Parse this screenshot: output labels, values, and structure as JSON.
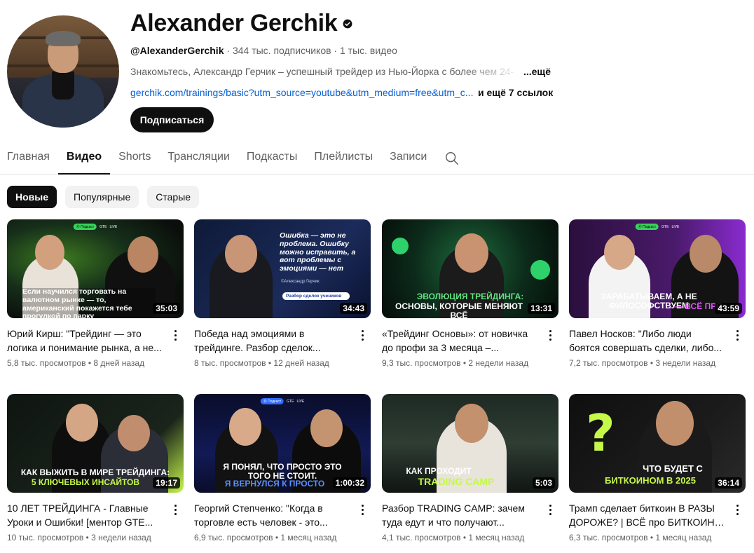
{
  "channel": {
    "name": "Alexander Gerchik",
    "handle": "@AlexanderGerchik",
    "stats": " · 344 тыс. подписчиков · 1 тыс. видео",
    "description": "Знакомьтесь, Александр Герчик – успешный трейдер из Нью-Йорка с более чем 24-",
    "description_more": "...ещё",
    "link": "gerchik.com/trainings/basic?utm_source=youtube&utm_medium=free&utm_c...",
    "links_more": "и ещё 7 ссылок",
    "subscribe_label": "Подписаться"
  },
  "tabs": [
    {
      "label": "Главная",
      "active": false
    },
    {
      "label": "Видео",
      "active": true
    },
    {
      "label": "Shorts",
      "active": false
    },
    {
      "label": "Трансляции",
      "active": false
    },
    {
      "label": "Подкасты",
      "active": false
    },
    {
      "label": "Плейлисты",
      "active": false
    },
    {
      "label": "Записи",
      "active": false
    }
  ],
  "chips": [
    {
      "label": "Новые",
      "active": true
    },
    {
      "label": "Популярные",
      "active": false
    },
    {
      "label": "Старые",
      "active": false
    }
  ],
  "videos": [
    {
      "title": "Юрий Кирш: \"Трейдинг — это логика и понимание рынка, а не...",
      "views": "5,8 тыс. просмотров",
      "age": "8 дней назад",
      "duration": "35:03",
      "thumb_text": "Если научился торговать на валютном рынке — то, американский покажется тебе прогулкой по парку"
    },
    {
      "title": "Победа над эмоциями в трейдинге. Разбор сделок...",
      "views": "8 тыс. просмотров",
      "age": "12 дней назад",
      "duration": "34:43",
      "thumb_text": "Ошибка — это не проблема. Ошибку можно исправить, а вот проблемы с эмоциями — нет",
      "thumb_sub": "©Александр Герчик",
      "thumb_tag": "Разбор сделок учеников"
    },
    {
      "title": "«Трейдинг Основы»: от новичка до профи за 3 месяца –...",
      "views": "9,3 тыс. просмотров",
      "age": "2 недели назад",
      "duration": "13:31",
      "thumb_text_acc": "ЭВОЛЮЦИЯ ТРЕЙДИНГА:",
      "thumb_text": "ОСНОВЫ, КОТОРЫЕ МЕНЯЮТ ВСЁ"
    },
    {
      "title": "Павел Носков: \"Либо люди боятся совершать сделки, либо...",
      "views": "7,2 тыс. просмотров",
      "age": "3 недели назад",
      "duration": "43:59",
      "thumb_text": "ЗАРАБАТЫВАЕМ, А НЕ ФИЛОСОФСТВУЕМ",
      "thumb_text_acc": "— ВСЁ ПРО"
    },
    {
      "title": "10 ЛЕТ ТРЕЙДИНГА - Главные Уроки и Ошибки! [ментор GTE...",
      "views": "10 тыс. просмотров",
      "age": "3 недели назад",
      "duration": "19:17",
      "thumb_text": "КАК ВЫЖИТЬ В МИРЕ ТРЕЙДИНГА:",
      "thumb_text_acc": "5 КЛЮЧЕВЫХ ИНСАЙТОВ"
    },
    {
      "title": "Георгий Степченко: \"Когда в торговле есть человек - это...",
      "views": "6,9 тыс. просмотров",
      "age": "1 месяц назад",
      "duration": "1:00:32",
      "thumb_text": "Я ПОНЯЛ, ЧТО ПРОСТО ЭТО ТОГО НЕ СТОИТ.",
      "thumb_text_acc": "Я ВЕРНУЛСЯ К ПРОСТО"
    },
    {
      "title": "Разбор TRADING CAMP: зачем туда едут и что получают...",
      "views": "4,1 тыс. просмотров",
      "age": "1 месяц назад",
      "duration": "5:03",
      "thumb_text": "КАК ПРОХОДИТ",
      "thumb_text_acc": "TRADING CAMP"
    },
    {
      "title": "Трамп сделает биткоин В РАЗЫ ДОРОЖЕ? | ВСЁ про БИТКОИН в...",
      "views": "6,3 тыс. просмотров",
      "age": "1 месяц назад",
      "duration": "36:14",
      "thumb_text": "ЧТО БУДЕТ С",
      "thumb_text_acc": "БИТКОИНОМ В 2025"
    }
  ],
  "thumb_badge": {
    "pill": "Ⓡ Подкаст",
    "a": "GTE",
    "b": "LIVE"
  },
  "icons": {
    "verified": "verified-check-icon",
    "search": "search-icon",
    "more": "more-vert-icon"
  },
  "colors": {
    "accent_lime": "#c6f84a",
    "link": "#065fd4",
    "text": "#0f0f0f",
    "secondary": "#606060"
  }
}
